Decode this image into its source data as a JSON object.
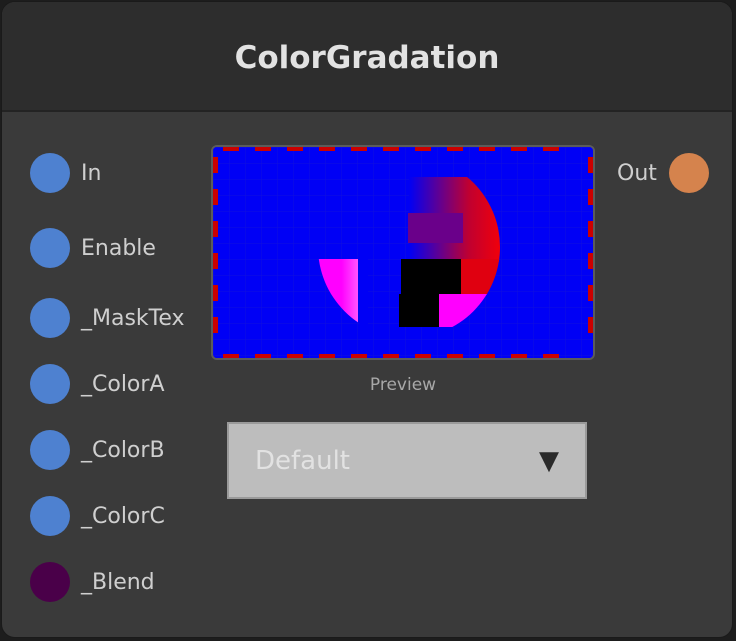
{
  "node": {
    "title": "ColorGradation"
  },
  "inputs": [
    {
      "label": "In",
      "color": "#4e81d0"
    },
    {
      "label": "Enable",
      "color": "#4e81d0"
    },
    {
      "label": "_MaskTex",
      "color": "#4e81d0"
    },
    {
      "label": "_ColorA",
      "color": "#4e81d0"
    },
    {
      "label": "_ColorB",
      "color": "#4e81d0"
    },
    {
      "label": "_ColorC",
      "color": "#4e81d0"
    },
    {
      "label": "_Blend",
      "color": "#4a0049"
    }
  ],
  "output": {
    "label": "Out",
    "color": "#d5834d"
  },
  "preview": {
    "label": "Preview"
  },
  "dropdown": {
    "value": "Default",
    "icon": "chevron-down-icon",
    "glyph": "▼"
  }
}
